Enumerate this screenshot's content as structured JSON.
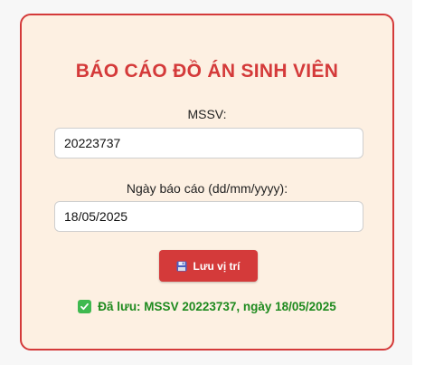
{
  "form": {
    "title": "BÁO CÁO ĐỒ ÁN SINH VIÊN",
    "mssv_label": "MSSV:",
    "mssv_value": "20223737",
    "date_label": "Ngày báo cáo (dd/mm/yyyy):",
    "date_value": "18/05/2025",
    "save_label": "Lưu vị trí",
    "save_icon": "floppy-disk-icon"
  },
  "status": {
    "icon": "check-box-icon",
    "message": "Đã lưu: MSSV 20223737, ngày 18/05/2025"
  },
  "colors": {
    "accent": "#d43a3a",
    "card_bg": "#fdf0e2",
    "success": "#1e8a1e"
  }
}
